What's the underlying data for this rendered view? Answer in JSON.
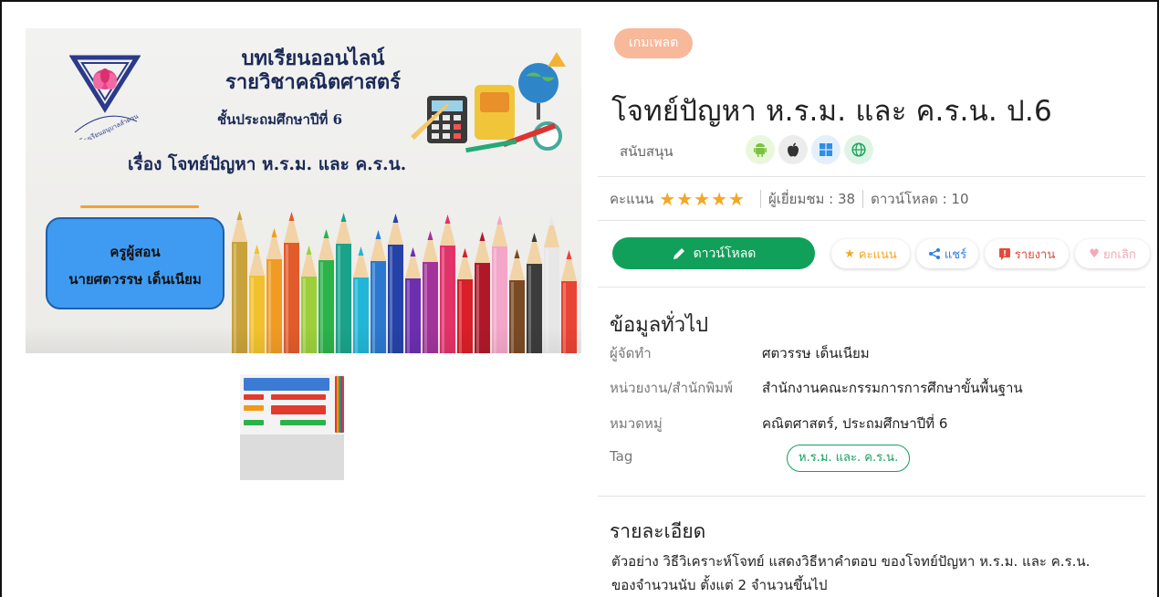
{
  "cover": {
    "title_line1": "บทเรียนออนไลน์",
    "title_line2": "รายวิชาคณิตศาสตร์",
    "grade": "ชั้นประถมศึกษาปีที่ 6",
    "topic": "เรื่อง โจทย์ปัญหา ห.ร.ม. และ ค.ร.น.",
    "teacher_role": "ครูผู้สอน",
    "teacher_name": "นายศตวรรษ  เด็นเนียม",
    "school_text": "โรงเรียนอนุบาลลำดวน"
  },
  "category_pill": "เกมเพลต",
  "title": "โจทย์ปัญหา ห.ร.ม. และ ค.ร.น. ป.6",
  "support": {
    "label": "สนับสนุน",
    "platforms": [
      {
        "icon": "android-icon",
        "bg": "#eaf7dd",
        "color": "#7cc242"
      },
      {
        "icon": "apple-icon",
        "bg": "#ececec",
        "color": "#333333"
      },
      {
        "icon": "windows-icon",
        "bg": "#e3f0fb",
        "color": "#2f8ee8"
      },
      {
        "icon": "globe-icon",
        "bg": "#def5e6",
        "color": "#20a35a"
      }
    ]
  },
  "stats": {
    "rating_label": "คะแนน",
    "rating": 5,
    "views": "ผู้เยี่ยมชม : 38",
    "downloads": "ดาวน์โหลด : 10"
  },
  "actions": {
    "download": "ดาวน์โหลด",
    "rate": "คะแนน",
    "share": "แชร์",
    "report": "รายงาน",
    "unlike": "ยกเลิก"
  },
  "colors": {
    "primary_green": "#11a05a",
    "pill_orange": "#f8b89a",
    "star": "#f5a623",
    "report_red": "#e04b3c",
    "share_blue": "#2f7fe0",
    "unlike_pink": "#f2a8b8"
  },
  "info": {
    "heading": "ข้อมูลทั่วไป",
    "rows": [
      {
        "label": "ผู้จัดทำ",
        "value": "ศตวรรษ เด็นเนียม"
      },
      {
        "label": "หน่วยงาน/สำนักพิมพ์",
        "value": "สำนักงานคณะกรรมการการศึกษาขั้นพื้นฐาน"
      },
      {
        "label": "หมวดหมู่",
        "value": "คณิตศาสตร์, ประถมศึกษาปีที่ 6"
      },
      {
        "label": "Tag",
        "value": "ห.ร.ม. และ. ค.ร.น."
      }
    ]
  },
  "details": {
    "heading": "รายละเอียด",
    "text_line1": "ตัวอย่าง วิธีวิเคราะห์โจทย์ แสดงวิธีหาคำตอบ ของโจทย์ปัญหา ห.ร.ม. และ ค.ร.น.",
    "text_line2": "ของจำนวนนับ ตั้งแต่ 2 จำนวนขึ้นไป"
  }
}
